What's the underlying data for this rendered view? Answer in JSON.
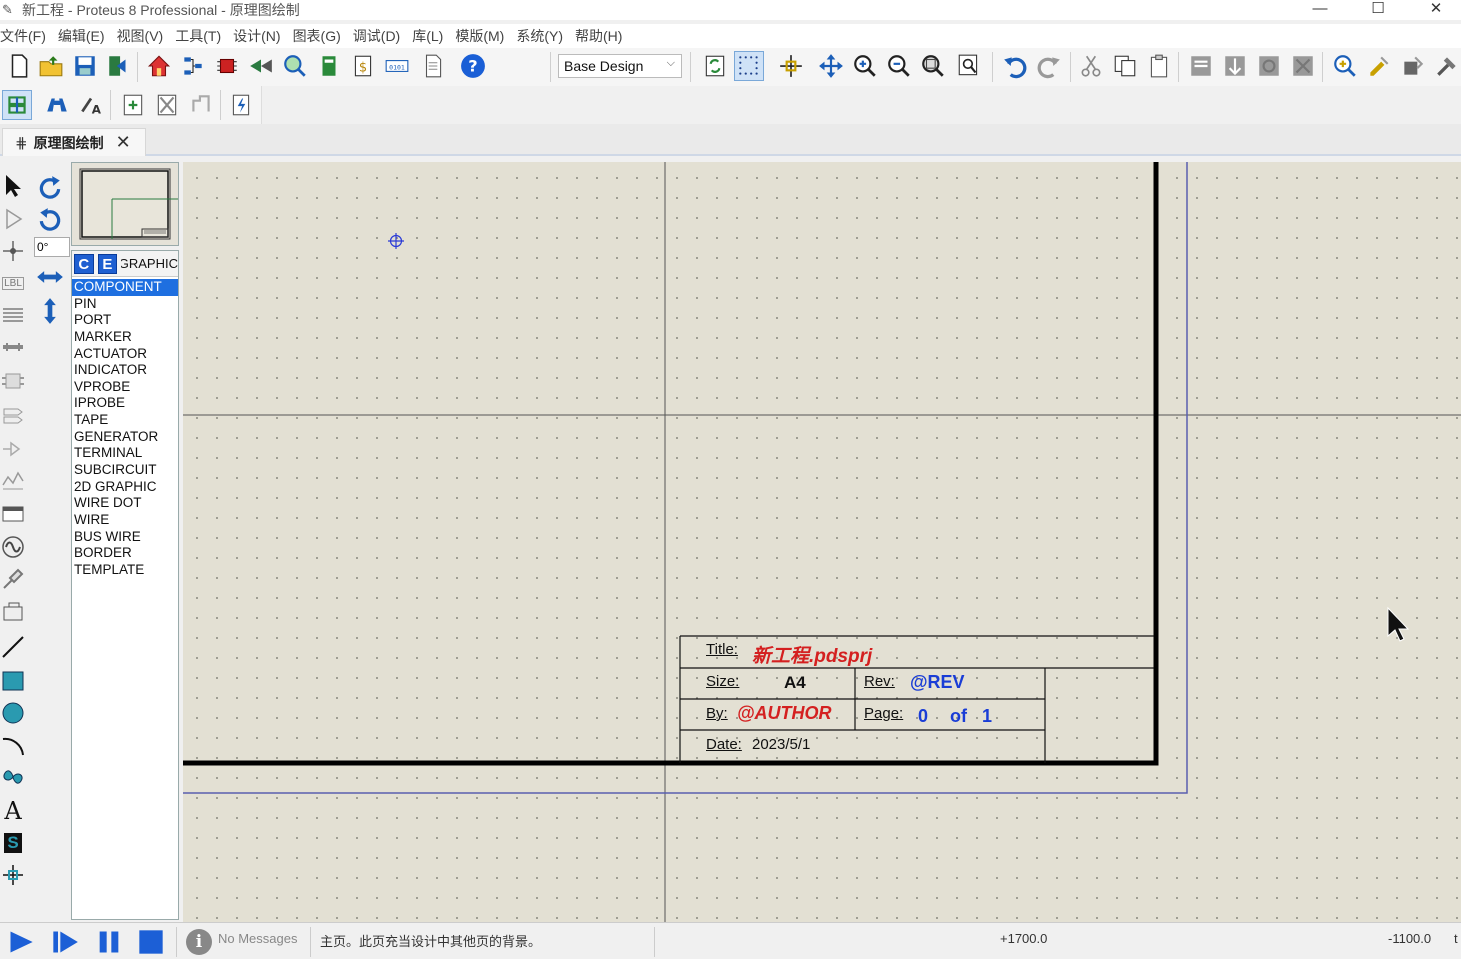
{
  "window": {
    "title": "新工程 - Proteus 8 Professional - 原理图绘制",
    "minimize": "—",
    "maximize": "☐",
    "close": "✕"
  },
  "menu": [
    "文件(F)",
    "编辑(E)",
    "视图(V)",
    "工具(T)",
    "设计(N)",
    "图表(G)",
    "调试(D)",
    "库(L)",
    "模版(M)",
    "系统(Y)",
    "帮助(H)"
  ],
  "toolbar": {
    "variant_select": "Base Design",
    "help_icon": "?"
  },
  "tab": {
    "label": "原理图绘制",
    "close": "✕"
  },
  "rotation": {
    "angle": "0°"
  },
  "object_selector": {
    "btn_c": "C",
    "btn_e": "E",
    "mode_label": "GRAPHIC",
    "items": [
      "COMPONENT",
      "PIN",
      "PORT",
      "MARKER",
      "ACTUATOR",
      "INDICATOR",
      "VPROBE",
      "IPROBE",
      "TAPE",
      "GENERATOR",
      "TERMINAL",
      "SUBCIRCUIT",
      "2D GRAPHIC",
      "WIRE DOT",
      "WIRE",
      "BUS WIRE",
      "BORDER",
      "TEMPLATE"
    ],
    "selected": "COMPONENT"
  },
  "modes": {
    "label_mode": "LBL",
    "text_mode": "A",
    "symbol_mode": "S"
  },
  "title_block": {
    "title_label": "Title:",
    "title_value": "新工程.pdsprj",
    "size_label": "Size:",
    "size_value": "A4",
    "rev_label": "Rev:",
    "rev_value": "@REV",
    "by_label": "By:",
    "by_value": "@AUTHOR",
    "page_label": "Page:",
    "page_value": "0",
    "page_of": "of",
    "page_total": "1",
    "date_label": "Date:",
    "date_value": "2023/5/1"
  },
  "status": {
    "messages": "No Messages",
    "info_icon": "i",
    "description": "主页。此页充当设计中其他页的背景。",
    "x_coord": "+1700.0",
    "y_coord": "-1100.0",
    "units": "t"
  },
  "colors": {
    "canvas_bg": "#e3e0d3",
    "accent_blue": "#1e6fe0",
    "title_red": "#d42020"
  }
}
